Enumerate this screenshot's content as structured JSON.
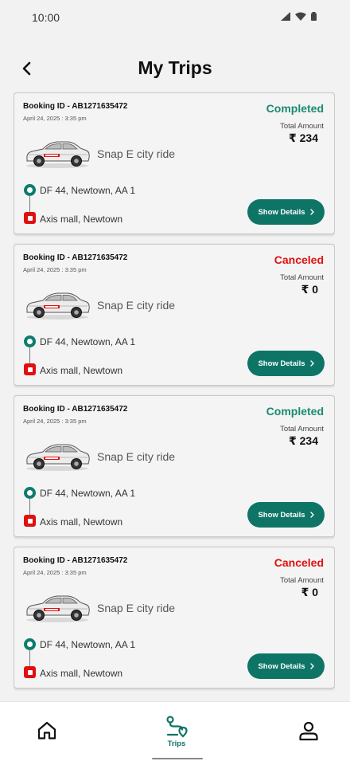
{
  "status_bar": {
    "time": "10:00"
  },
  "header": {
    "title": "My Trips"
  },
  "colors": {
    "accent": "#0e7566",
    "completed": "#1a8a72",
    "canceled": "#e01010",
    "drop": "#e01010"
  },
  "trips": [
    {
      "booking_id": "Booking ID - AB1271635472",
      "date": "April 24, 2025 : 3:35 pm",
      "status": "Completed",
      "status_type": "completed",
      "total_label": "Total Amount",
      "amount": "₹ 234",
      "ride_name": "Snap E city ride",
      "pickup": "DF 44, Newtown, AA 1",
      "drop": "Axis mall, Newtown",
      "button_label": "Show Details"
    },
    {
      "booking_id": "Booking ID - AB1271635472",
      "date": "April 24, 2025 : 3:35 pm",
      "status": "Canceled",
      "status_type": "canceled",
      "total_label": "Total Amount",
      "amount": "₹ 0",
      "ride_name": "Snap E city ride",
      "pickup": "DF 44, Newtown, AA 1",
      "drop": "Axis mall, Newtown",
      "button_label": "Show Details"
    },
    {
      "booking_id": "Booking ID - AB1271635472",
      "date": "April 24, 2025 : 3:35 pm",
      "status": "Completed",
      "status_type": "completed",
      "total_label": "Total Amount",
      "amount": "₹ 234",
      "ride_name": "Snap E city ride",
      "pickup": "DF 44, Newtown, AA 1",
      "drop": "Axis mall, Newtown",
      "button_label": "Show Details"
    },
    {
      "booking_id": "Booking ID - AB1271635472",
      "date": "April 24, 2025 : 3:35 pm",
      "status": "Canceled",
      "status_type": "canceled",
      "total_label": "Total Amount",
      "amount": "₹ 0",
      "ride_name": "Snap E city ride",
      "pickup": "DF 44, Newtown, AA 1",
      "drop": "Axis mall, Newtown",
      "button_label": "Show Details"
    }
  ],
  "bottom_nav": {
    "home_icon": "home-icon",
    "trips_label": "Trips",
    "trips_icon": "route-icon",
    "profile_icon": "user-icon",
    "active": "trips"
  }
}
